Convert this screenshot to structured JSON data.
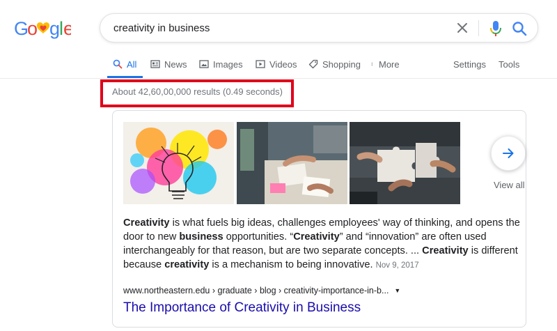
{
  "logo": {
    "text": "Google"
  },
  "search": {
    "query": "creativity in business"
  },
  "tabs": [
    {
      "label": "All",
      "icon": "search-icon",
      "active": true
    },
    {
      "label": "News",
      "icon": "news-icon"
    },
    {
      "label": "Images",
      "icon": "image-icon"
    },
    {
      "label": "Videos",
      "icon": "play-icon"
    },
    {
      "label": "Shopping",
      "icon": "tag-icon"
    },
    {
      "label": "More",
      "icon": "more-vert-icon"
    }
  ],
  "tools": {
    "settings": "Settings",
    "tools": "Tools"
  },
  "result_stats": "About 42,60,00,000 results (0.49 seconds)",
  "highlight_color": "#e0001a",
  "featured": {
    "images": [
      "colorful-lightbulb-painting",
      "team-working-on-papers",
      "hands-holding-puzzle-pieces"
    ],
    "view_all": "View all",
    "snippet": {
      "w1": "Creativity",
      "t1": " is what fuels big ideas, challenges employees' way of thinking, and opens the door to new ",
      "w2": "business",
      "t2": " opportunities. “",
      "w3": "Creativity",
      "t3": "” and “innovation” are often used interchangeably for that reason, but are two separate concepts. ... ",
      "w4": "Creativity",
      "t4": " is different because ",
      "w5": "creativity",
      "t5": " is a mechanism to being innovative.",
      "date": "Nov 9, 2017"
    },
    "cite": "www.northeastern.edu › graduate › blog › creativity-importance-in-b...",
    "title": "The Importance of Creativity in Business"
  },
  "colors": {
    "link": "#1a0dab",
    "accent": "#1a73e8",
    "muted": "#70757a"
  }
}
